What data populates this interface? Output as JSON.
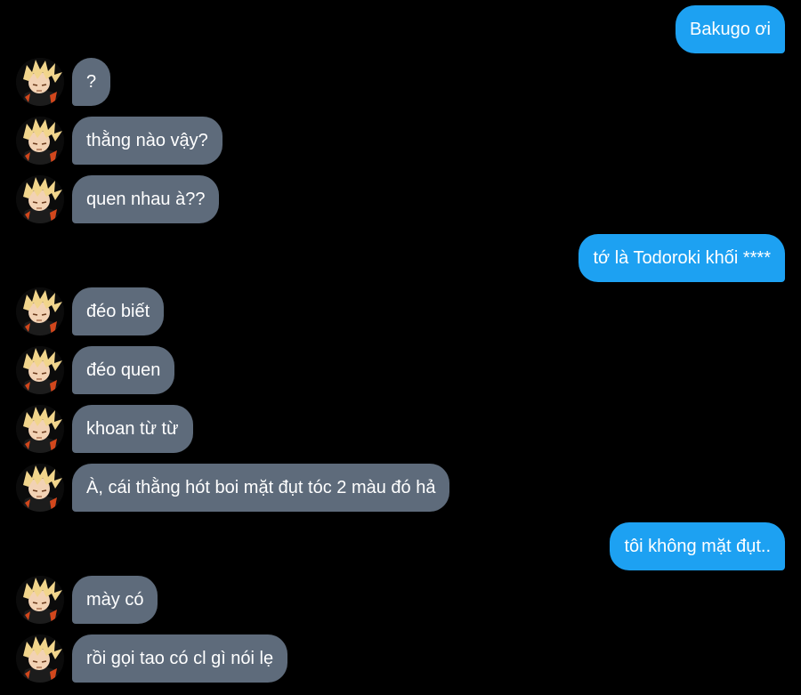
{
  "colors": {
    "background": "#000000",
    "sent_bubble": "#1da1f2",
    "received_bubble": "#5e6b7b",
    "text": "#ffffff"
  },
  "avatar_icon": "bakugo-avatar-icon",
  "messages": [
    {
      "side": "sent",
      "text": "Bakugo ơi"
    },
    {
      "side": "received",
      "text": "?"
    },
    {
      "side": "received",
      "text": "thằng nào vậy?"
    },
    {
      "side": "received",
      "text": "quen nhau à??"
    },
    {
      "side": "sent",
      "text": "tớ là Todoroki khối ****"
    },
    {
      "side": "received",
      "text": "đéo biết"
    },
    {
      "side": "received",
      "text": "đéo quen"
    },
    {
      "side": "received",
      "text": "khoan từ từ"
    },
    {
      "side": "received",
      "text": "À, cái thằng hót boi mặt đụt tóc 2 màu đó hả"
    },
    {
      "side": "sent",
      "text": "tôi không mặt đụt.."
    },
    {
      "side": "received",
      "text": "mày có"
    },
    {
      "side": "received",
      "text": "rồi gọi tao có cl gì nói lẹ"
    }
  ]
}
